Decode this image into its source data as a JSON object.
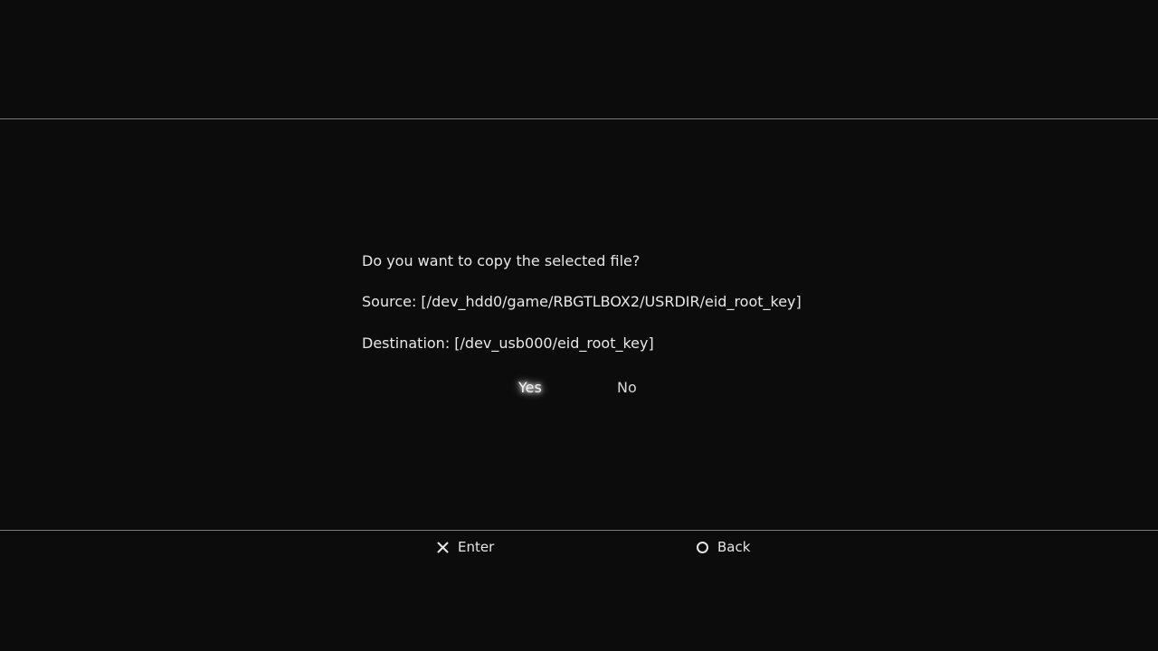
{
  "dialog": {
    "question": "Do you want to copy the selected file?",
    "source": "Source: [/dev_hdd0/game/RBGTLBOX2/USRDIR/eid_root_key]",
    "destination": "Destination: [/dev_usb000/eid_root_key]"
  },
  "choices": {
    "yes_label": "Yes",
    "no_label": "No",
    "selected": "Yes"
  },
  "footer": {
    "enter_icon": "cross-button-icon",
    "enter_label": "Enter",
    "back_icon": "circle-button-icon",
    "back_label": "Back"
  },
  "colors": {
    "background": "#0c0c0c",
    "text": "#e6e6e6",
    "divider": "#7a7a7a"
  }
}
